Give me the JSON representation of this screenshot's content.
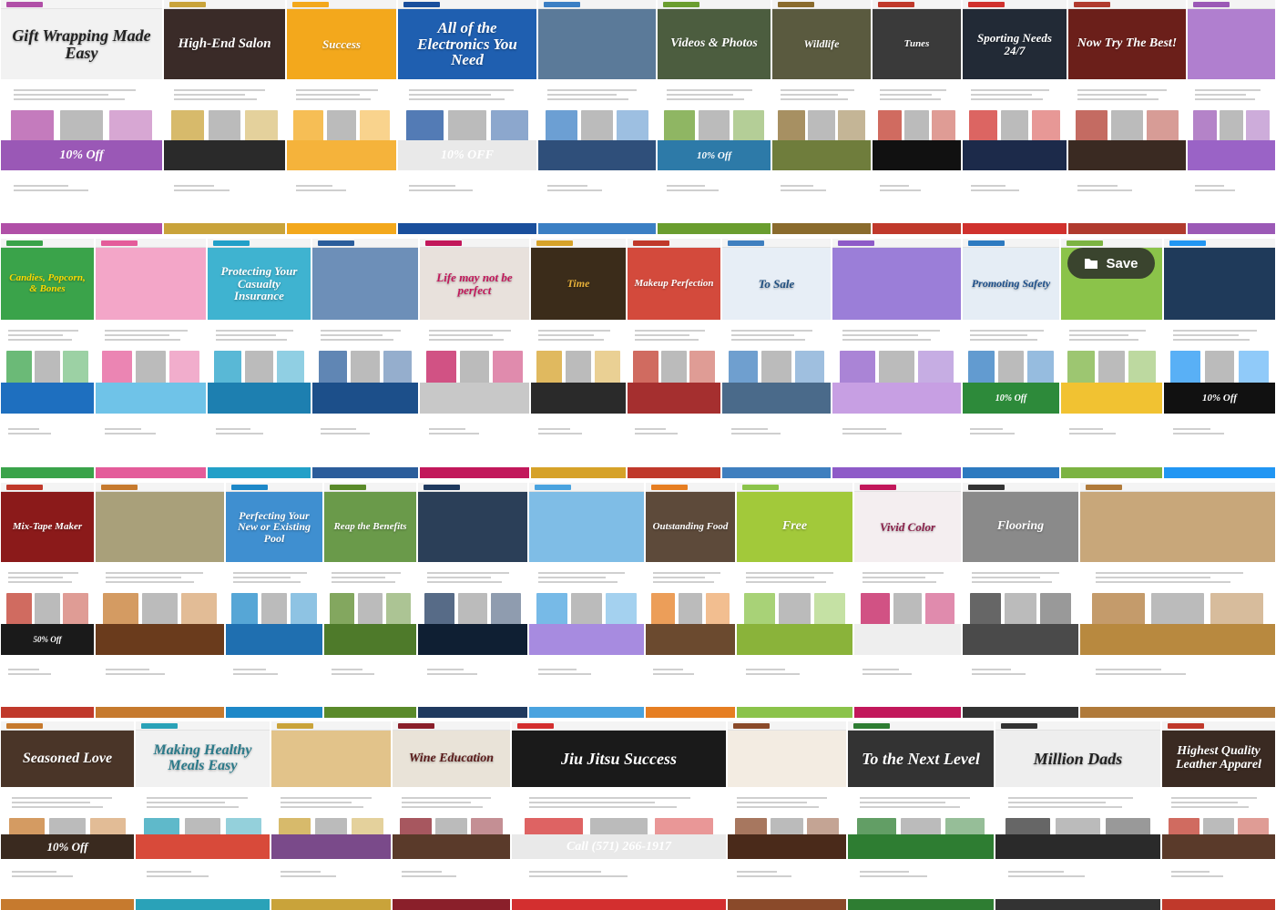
{
  "save_button": {
    "label": "Save"
  },
  "tiles": [
    {
      "hero": "Gift Wrapping Made Easy",
      "accent": "#b04fa7",
      "heroBg": "#f2f2f2",
      "heroColor": "#222",
      "band": "#9a58b6",
      "bandText": "10% Off"
    },
    {
      "hero": "High-End Salon",
      "accent": "#c9a33a",
      "heroBg": "#3a2b28",
      "heroColor": "#fff",
      "band": "#2a2a2a",
      "bandText": ""
    },
    {
      "hero": "Success",
      "accent": "#f3a81c",
      "heroBg": "#f3a81c",
      "heroColor": "#fff",
      "band": "#f5b33b",
      "bandText": ""
    },
    {
      "hero": "All of the Electronics You Need",
      "accent": "#1a4f9c",
      "heroBg": "#1f5fb0",
      "heroColor": "#fff",
      "band": "#e9e9e9",
      "bandText": "10% OFF"
    },
    {
      "hero": "",
      "accent": "#3b7fc4",
      "heroBg": "#5b7a99",
      "heroColor": "#fff",
      "band": "#2f4f7a",
      "bandText": ""
    },
    {
      "hero": "Videos & Photos",
      "accent": "#6a9d2f",
      "heroBg": "#4c5d3f",
      "heroColor": "#fff",
      "band": "#2d7aa8",
      "bandText": "10% Off"
    },
    {
      "hero": "Wildlife",
      "accent": "#8a6b2d",
      "heroBg": "#5a5a3f",
      "heroColor": "#fff",
      "band": "#6f7d3c",
      "bandText": ""
    },
    {
      "hero": "Tunes",
      "accent": "#c0392b",
      "heroBg": "#3a3a3a",
      "heroColor": "#fff",
      "band": "#111111",
      "bandText": ""
    },
    {
      "hero": "Sporting Needs 24/7",
      "accent": "#d0312d",
      "heroBg": "#222a36",
      "heroColor": "#fff",
      "band": "#1c2a4a",
      "bandText": ""
    },
    {
      "hero": "Now Try The Best!",
      "accent": "#b03a2e",
      "heroBg": "#6b1f1a",
      "heroColor": "#fff",
      "band": "#3a2a22",
      "bandText": ""
    },
    {
      "hero": "",
      "accent": "#9b59b6",
      "heroBg": "#b07fcf",
      "heroColor": "#fff",
      "band": "#9a63c6",
      "bandText": ""
    },
    {
      "hero": "Candies, Popcorn, & Bones",
      "accent": "#3aa34a",
      "heroBg": "#3aa34a",
      "heroColor": "#ffd800",
      "band": "#1e6fbf",
      "bandText": ""
    },
    {
      "hero": "",
      "accent": "#e45c9a",
      "heroBg": "#f3a6c8",
      "heroColor": "#fff",
      "band": "#6fc3e8",
      "bandText": ""
    },
    {
      "hero": "Protecting Your Casualty Insurance",
      "accent": "#22a0c8",
      "heroBg": "#3fb3d0",
      "heroColor": "#fff",
      "band": "#1d7fb0",
      "bandText": ""
    },
    {
      "hero": "",
      "accent": "#2b5d9b",
      "heroBg": "#6d8fb8",
      "heroColor": "#fff",
      "band": "#1c4f8a",
      "bandText": ""
    },
    {
      "hero": "Life may not be perfect",
      "accent": "#c2185b",
      "heroBg": "#e8e1dc",
      "heroColor": "#c2185b",
      "band": "#c8c8c8",
      "bandText": ""
    },
    {
      "hero": "Time",
      "accent": "#d6a229",
      "heroBg": "#3b2c1a",
      "heroColor": "#e9b23a",
      "band": "#2a2a2a",
      "bandText": ""
    },
    {
      "hero": "Makeup Perfection",
      "accent": "#c0392b",
      "heroBg": "#d34a3c",
      "heroColor": "#fff",
      "band": "#a52f2f",
      "bandText": ""
    },
    {
      "hero": "To Sale",
      "accent": "#3f7fbf",
      "heroBg": "#e7eef6",
      "heroColor": "#1f4f80",
      "band": "#4a6a8a",
      "bandText": ""
    },
    {
      "hero": "",
      "accent": "#8e5bc8",
      "heroBg": "#9b7ed8",
      "heroColor": "#fff",
      "band": "#c79fe3",
      "bandText": ""
    },
    {
      "hero": "Promoting Safety",
      "accent": "#2d7ac0",
      "heroBg": "#e5edf5",
      "heroColor": "#1d4f8a",
      "band": "#2d8a3a",
      "bandText": "10% Off"
    },
    {
      "hero": "",
      "accent": "#7cb342",
      "heroBg": "#8bc34a",
      "heroColor": "#fff",
      "band": "#f1c232",
      "bandText": ""
    },
    {
      "hero": "",
      "accent": "#2196f3",
      "heroBg": "#1f3a5a",
      "heroColor": "#fff",
      "band": "#111111",
      "bandText": "10% Off"
    },
    {
      "hero": "Mix-Tape Maker",
      "accent": "#c0392b",
      "heroBg": "#8b1a1a",
      "heroColor": "#fff",
      "band": "#1a1a1a",
      "bandText": "50% Off"
    },
    {
      "hero": "",
      "accent": "#c67a2e",
      "heroBg": "#a9a07a",
      "heroColor": "#fff",
      "band": "#6a3b1c",
      "bandText": ""
    },
    {
      "hero": "Perfecting Your New or Existing Pool",
      "accent": "#1e88c8",
      "heroBg": "#3f8fd0",
      "heroColor": "#fff",
      "band": "#1f6fb0",
      "bandText": ""
    },
    {
      "hero": "Reap the Benefits",
      "accent": "#5a8a2a",
      "heroBg": "#6a9a4a",
      "heroColor": "#fff",
      "band": "#4e7a2a",
      "bandText": ""
    },
    {
      "hero": "",
      "accent": "#1f3a5f",
      "heroBg": "#2b3f58",
      "heroColor": "#fff",
      "band": "#0f1f33",
      "bandText": ""
    },
    {
      "hero": "",
      "accent": "#4aa3df",
      "heroBg": "#7fbde6",
      "heroColor": "#fff",
      "band": "#a78be0",
      "bandText": ""
    },
    {
      "hero": "Outstanding Food",
      "accent": "#e67e22",
      "heroBg": "#5d4a3a",
      "heroColor": "#fff",
      "band": "#6b4a2f",
      "bandText": ""
    },
    {
      "hero": "Free",
      "accent": "#8bc34a",
      "heroBg": "#a2c93a",
      "heroColor": "#fff",
      "band": "#8ab33a",
      "bandText": ""
    },
    {
      "hero": "Vivid Color",
      "accent": "#c2185b",
      "heroBg": "#f4eef0",
      "heroColor": "#8a1f4a",
      "band": "#eeeeee",
      "bandText": ""
    },
    {
      "hero": "Flooring",
      "accent": "#333333",
      "heroBg": "#8a8a8a",
      "heroColor": "#fff",
      "band": "#4a4a4a",
      "bandText": ""
    },
    {
      "hero": "",
      "accent": "#b07a3a",
      "heroBg": "#c8a77a",
      "heroColor": "#fff",
      "band": "#b8893f",
      "bandText": ""
    },
    {
      "hero": "Seasoned Love",
      "accent": "#c67a2e",
      "heroBg": "#4a3528",
      "heroColor": "#fff",
      "band": "#3a2a1f",
      "bandText": "10% Off"
    },
    {
      "hero": "Making Healthy Meals Easy",
      "accent": "#2aa2b8",
      "heroBg": "#f1f1f1",
      "heroColor": "#2a7a8a",
      "band": "#d84a3a",
      "bandText": ""
    },
    {
      "hero": "",
      "accent": "#c9a33a",
      "heroBg": "#e2c38a",
      "heroColor": "#fff",
      "band": "#7a4a8a",
      "bandText": ""
    },
    {
      "hero": "Wine Education",
      "accent": "#8a1f2a",
      "heroBg": "#e9e3d8",
      "heroColor": "#5a1a1a",
      "band": "#5a3a2a",
      "bandText": ""
    },
    {
      "hero": "Jiu Jitsu Success",
      "accent": "#d32f2f",
      "heroBg": "#1a1a1a",
      "heroColor": "#fff",
      "band": "#e9e9e9",
      "bandText": "Call (571) 266-1917"
    },
    {
      "hero": "",
      "accent": "#8a4a2a",
      "heroBg": "#f3ece2",
      "heroColor": "#6b3a1f",
      "band": "#4a2a1a",
      "bandText": ""
    },
    {
      "hero": "To the Next Level",
      "accent": "#2e7d32",
      "heroBg": "#333333",
      "heroColor": "#fff",
      "band": "#2e7d32",
      "bandText": ""
    },
    {
      "hero": "Million Dads",
      "accent": "#333333",
      "heroBg": "#eeeeee",
      "heroColor": "#222",
      "band": "#2a2a2a",
      "bandText": ""
    },
    {
      "hero": "Highest Quality Leather Apparel",
      "accent": "#c0392b",
      "heroBg": "#3a2a22",
      "heroColor": "#fff",
      "band": "#5a3a2a",
      "bandText": ""
    }
  ]
}
